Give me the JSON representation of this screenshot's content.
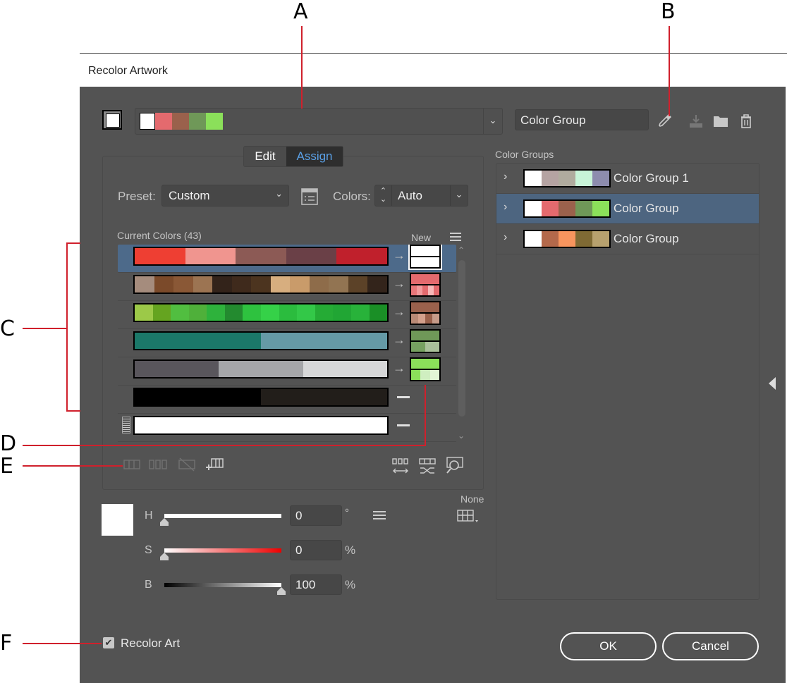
{
  "callouts": [
    "A",
    "B",
    "C",
    "D",
    "E",
    "F"
  ],
  "dialog": {
    "title": "Recolor Artwork",
    "top_bar": {
      "harmony_colors": [
        "#ffffff",
        "#e46a6e",
        "#9a614c",
        "#6f9858",
        "#8be05a"
      ],
      "group_name_value": "Color Group",
      "icons": [
        "eyedropper-icon",
        "save-group-icon",
        "new-folder-icon",
        "trash-icon"
      ]
    },
    "tabs": [
      {
        "label": "Edit",
        "active": false
      },
      {
        "label": "Assign",
        "active": true
      }
    ],
    "preset": {
      "label": "Preset:",
      "value": "Custom"
    },
    "colors": {
      "label": "Colors:",
      "value": "Auto"
    },
    "current_colors": {
      "header": "Current Colors (43)",
      "new_header": "New",
      "rows": [
        {
          "current": [
            "#ee3f33",
            "#f0958f",
            "#8c5a55",
            "#6a4047",
            "#c0202c"
          ],
          "new_top": [
            "#ffffff"
          ],
          "new_bottom": [
            "#ffffff"
          ],
          "selected": true,
          "mapped": true
        },
        {
          "current": [
            "#a58c7d",
            "#7b4a2a",
            "#8a5836",
            "#9c7452",
            "#33231a",
            "#3f2a1c",
            "#4c341f",
            "#d7ae7f",
            "#c99b6a",
            "#8e6c4a",
            "#927452",
            "#5c4228",
            "#33241b"
          ],
          "new_top": [
            "#e46a6e"
          ],
          "new_bottom": [
            "#e9777a",
            "#f39a9c",
            "#e46a6e",
            "#f7b8b8",
            "#e46a6e"
          ],
          "selected": false,
          "mapped": true
        },
        {
          "current": [
            "#9cc948",
            "#65a420",
            "#51be40",
            "#4fb03a",
            "#2eb23c",
            "#238a2f",
            "#2ec23f",
            "#35d148",
            "#2bbc3e",
            "#33c848",
            "#25ab35",
            "#21a634",
            "#28b23a",
            "#1a8f26"
          ],
          "new_top": [
            "#9a614c"
          ],
          "new_bottom": [
            "#b98a76",
            "#d3a08c",
            "#9a614c",
            "#c69b89"
          ],
          "selected": false,
          "mapped": true
        },
        {
          "current": [
            "#1b7869",
            "#659aa6"
          ],
          "new_top": [
            "#6f9858"
          ],
          "new_bottom": [
            "#76a060",
            "#a9c09a"
          ],
          "selected": false,
          "mapped": true
        },
        {
          "current": [
            "#59565c",
            "#a5a6a9",
            "#d6d7d8"
          ],
          "new_top": [
            "#8be05a"
          ],
          "new_bottom": [
            "#8be05a",
            "#cfeec0",
            "#e3f6d6"
          ],
          "selected": false,
          "mapped": true
        },
        {
          "current": [
            "#000000",
            "#221e1a"
          ],
          "selected": false,
          "mapped": false
        },
        {
          "current": [
            "#ffffff"
          ],
          "selected": false,
          "mapped": false,
          "locked_icon": true
        }
      ]
    },
    "hsb": {
      "h": {
        "label": "H",
        "value": "0",
        "unit": "°",
        "fraction": 0
      },
      "s": {
        "label": "S",
        "value": "0",
        "unit": "%",
        "fraction": 0
      },
      "b": {
        "label": "B",
        "value": "100",
        "unit": "%",
        "fraction": 1
      }
    },
    "none_label": "None",
    "color_groups": {
      "header": "Color Groups",
      "items": [
        {
          "label": "Color Group 1",
          "colors": [
            "#ffffff",
            "#b5a3a2",
            "#b0ab9e",
            "#c8f4d8",
            "#8d8cae"
          ],
          "selected": false
        },
        {
          "label": "Color Group",
          "colors": [
            "#ffffff",
            "#e46a6e",
            "#9a614c",
            "#6f9858",
            "#8be05a"
          ],
          "selected": true
        },
        {
          "label": "Color Group",
          "colors": [
            "#ffffff",
            "#b4694b",
            "#f8955e",
            "#7f6a34",
            "#b7a16e"
          ],
          "selected": false
        }
      ]
    },
    "recolor_art": {
      "label": "Recolor Art",
      "checked": true
    },
    "ok_label": "OK",
    "cancel_label": "Cancel"
  }
}
